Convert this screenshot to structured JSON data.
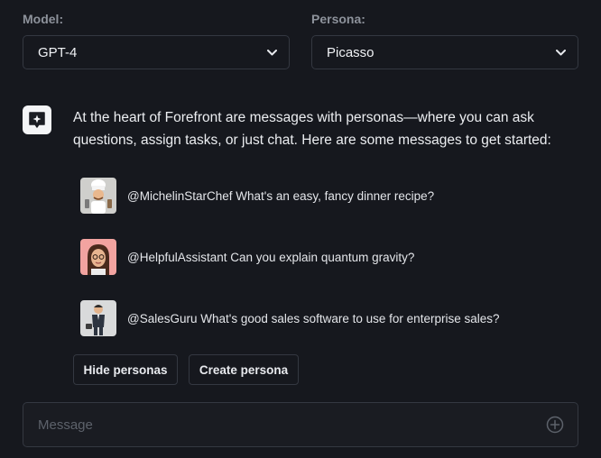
{
  "model": {
    "label": "Model:",
    "selected": "GPT-4"
  },
  "persona": {
    "label": "Persona:",
    "selected": "Picasso"
  },
  "intro": {
    "icon": "sparkle-chat-icon",
    "text": "At the heart of Forefront are messages with personas—where you can ask questions, assign tasks, or just chat. Here are some messages to get started:"
  },
  "suggestions": [
    {
      "avatar": "chef-avatar",
      "text": "@MichelinStarChef What's an easy, fancy dinner recipe?"
    },
    {
      "avatar": "assistant-avatar",
      "text": "@HelpfulAssistant Can you explain quantum gravity?"
    },
    {
      "avatar": "businessman-avatar",
      "text": "@SalesGuru What's good sales software to use for enterprise sales?"
    }
  ],
  "actions": {
    "hide_personas": "Hide personas",
    "create_persona": "Create persona"
  },
  "composer": {
    "placeholder": "Message",
    "add_icon": "plus-circle-icon"
  },
  "colors": {
    "background": "#16181e",
    "border": "#343841",
    "label": "#8d929b",
    "text": "#eceef1"
  }
}
